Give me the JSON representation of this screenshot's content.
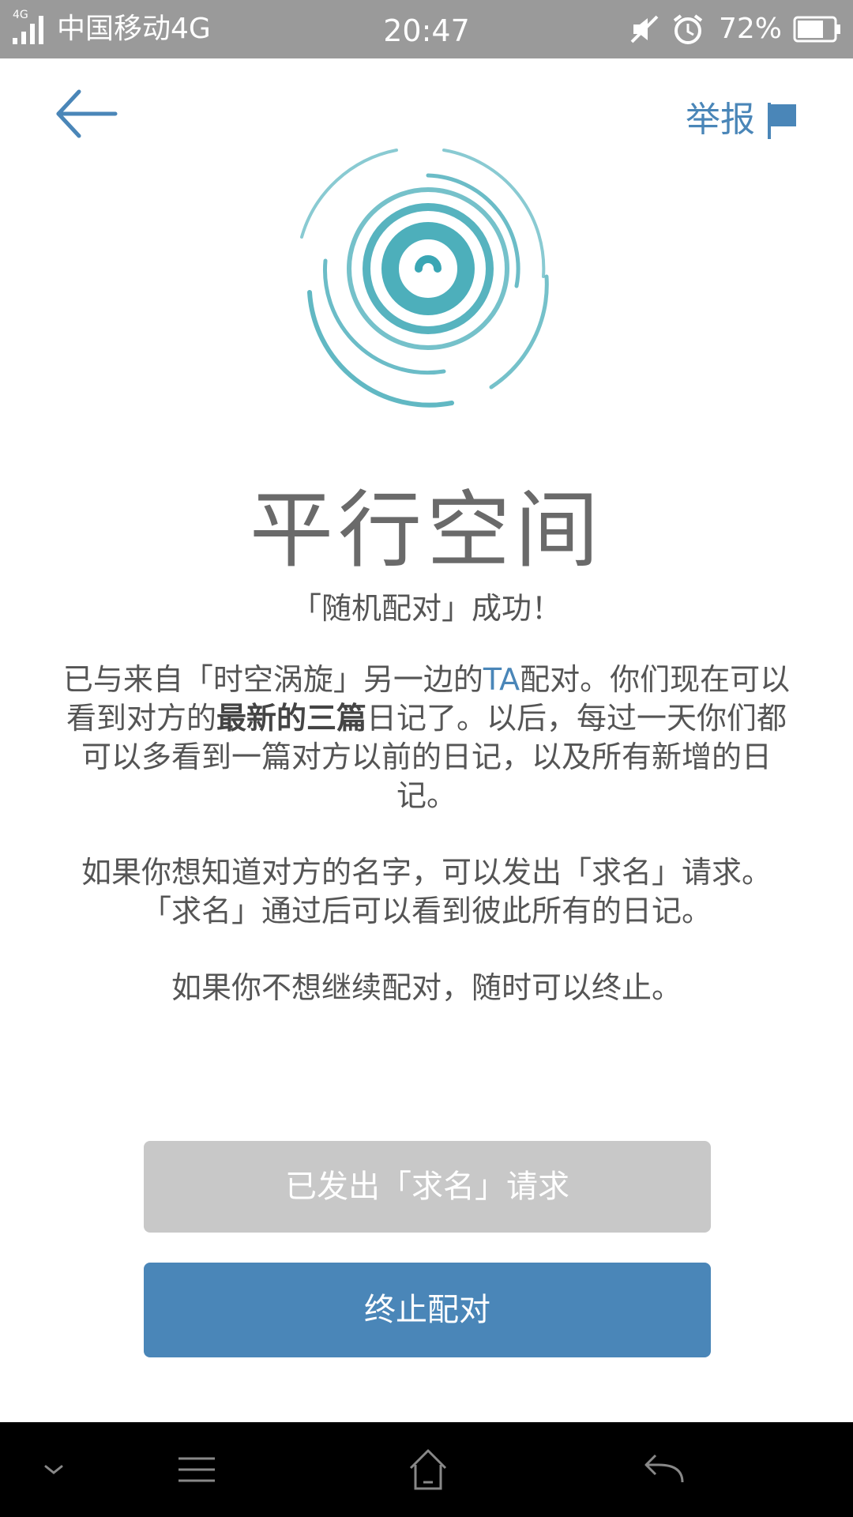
{
  "status_bar": {
    "network_small": "4G",
    "carrier": "中国移动4G",
    "time": "20:47",
    "battery": "72%",
    "icons": [
      "signal-icon",
      "mute-icon",
      "alarm-icon",
      "battery-icon"
    ]
  },
  "header": {
    "back_icon": "back-arrow-icon",
    "report_label": "举报",
    "report_icon": "flag-icon"
  },
  "logo_icon": "spiral-logo-icon",
  "title": "平行空间",
  "subtitle": "「随机配对」成功！",
  "paragraph1": {
    "part1": "已与来自「时空涡旋」另一边的",
    "highlight": "TA",
    "part2": "配对。你们现在可以看到对方的",
    "bold": "最新的三篇",
    "part3": "日记了。以后，每过一天你们都可以多看到一篇对方以前的日记，以及所有新增的日记。"
  },
  "paragraph2": "如果你想知道对方的名字，可以发出「求名」请求。「求名」通过后可以看到彼此所有的日记。",
  "paragraph3": "如果你不想继续配对，随时可以终止。",
  "buttons": {
    "request_name": "已发出「求名」请求",
    "stop_pairing": "终止配对"
  },
  "colors": {
    "accent": "#4a86b8",
    "disabled_button": "#c8c8c8",
    "status_bar": "#9a9a9a",
    "logo": "#3aa6b4"
  },
  "nav_bar": {
    "icons": [
      "chevron-down-icon",
      "menu-icon",
      "home-icon",
      "back-icon"
    ]
  }
}
